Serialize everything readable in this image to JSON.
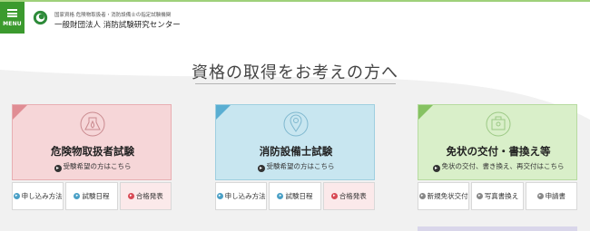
{
  "header": {
    "menu_label": "MENU",
    "org_sub": "国家資格 危険物取扱者・消防設備士の指定試験機関",
    "org_name": "一般財団法人 消防試験研究センター"
  },
  "main": {
    "heading": "資格の取得をお考えの方へ"
  },
  "colors": {
    "brand_green": "#3b9a2e",
    "card_pink": "#f6d6d8",
    "card_blue": "#c8e6f0",
    "card_green": "#d9efc9",
    "highlight_button": "#fbe9ea"
  },
  "cards": [
    {
      "title": "危険物取扱者試験",
      "subtitle": "受験希望の方はこちら",
      "icon": "flask-flame-icon",
      "buttons": [
        "申し込み方法",
        "試験日程",
        "合格発表"
      ]
    },
    {
      "title": "消防設備士試験",
      "subtitle": "受験希望の方はこちら",
      "icon": "map-pin-icon",
      "buttons": [
        "申し込み方法",
        "試験日程",
        "合格発表"
      ]
    },
    {
      "title": "免状の交付・書換え等",
      "subtitle": "免状の交付、書き換え、再交付はこちら",
      "icon": "certificate-icon",
      "buttons": [
        "新規免状交付",
        "写真書換え",
        "申請書"
      ]
    }
  ]
}
